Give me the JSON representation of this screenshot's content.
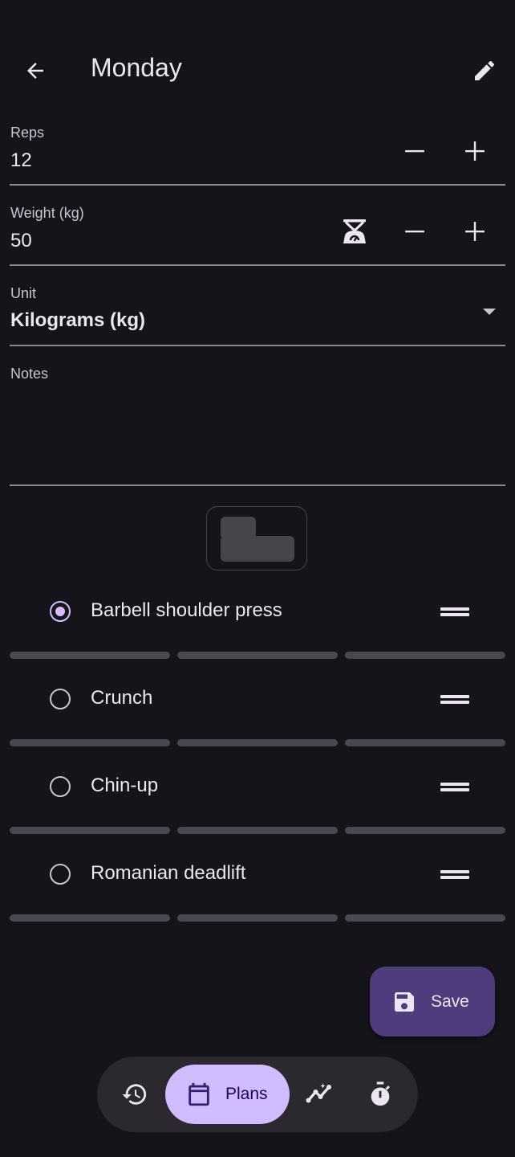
{
  "header": {
    "title": "Monday"
  },
  "fields": {
    "reps": {
      "label": "Reps",
      "value": "12"
    },
    "weight": {
      "label": "Weight (kg)",
      "value": "50"
    },
    "unit": {
      "label": "Unit",
      "value": "Kilograms (kg)"
    },
    "notes": {
      "label": "Notes",
      "value": ""
    }
  },
  "exercises": [
    {
      "label": "Barbell shoulder press",
      "selected": true
    },
    {
      "label": "Crunch",
      "selected": false
    },
    {
      "label": "Chin-up",
      "selected": false
    },
    {
      "label": "Romanian deadlift",
      "selected": false
    }
  ],
  "fab": {
    "label": "Save"
  },
  "nav": {
    "active_label": "Plans"
  },
  "colors": {
    "accent": "#d0bcff",
    "fab_bg": "#4f3c7c",
    "background": "#16131a",
    "nav_bg": "#2b2830"
  }
}
